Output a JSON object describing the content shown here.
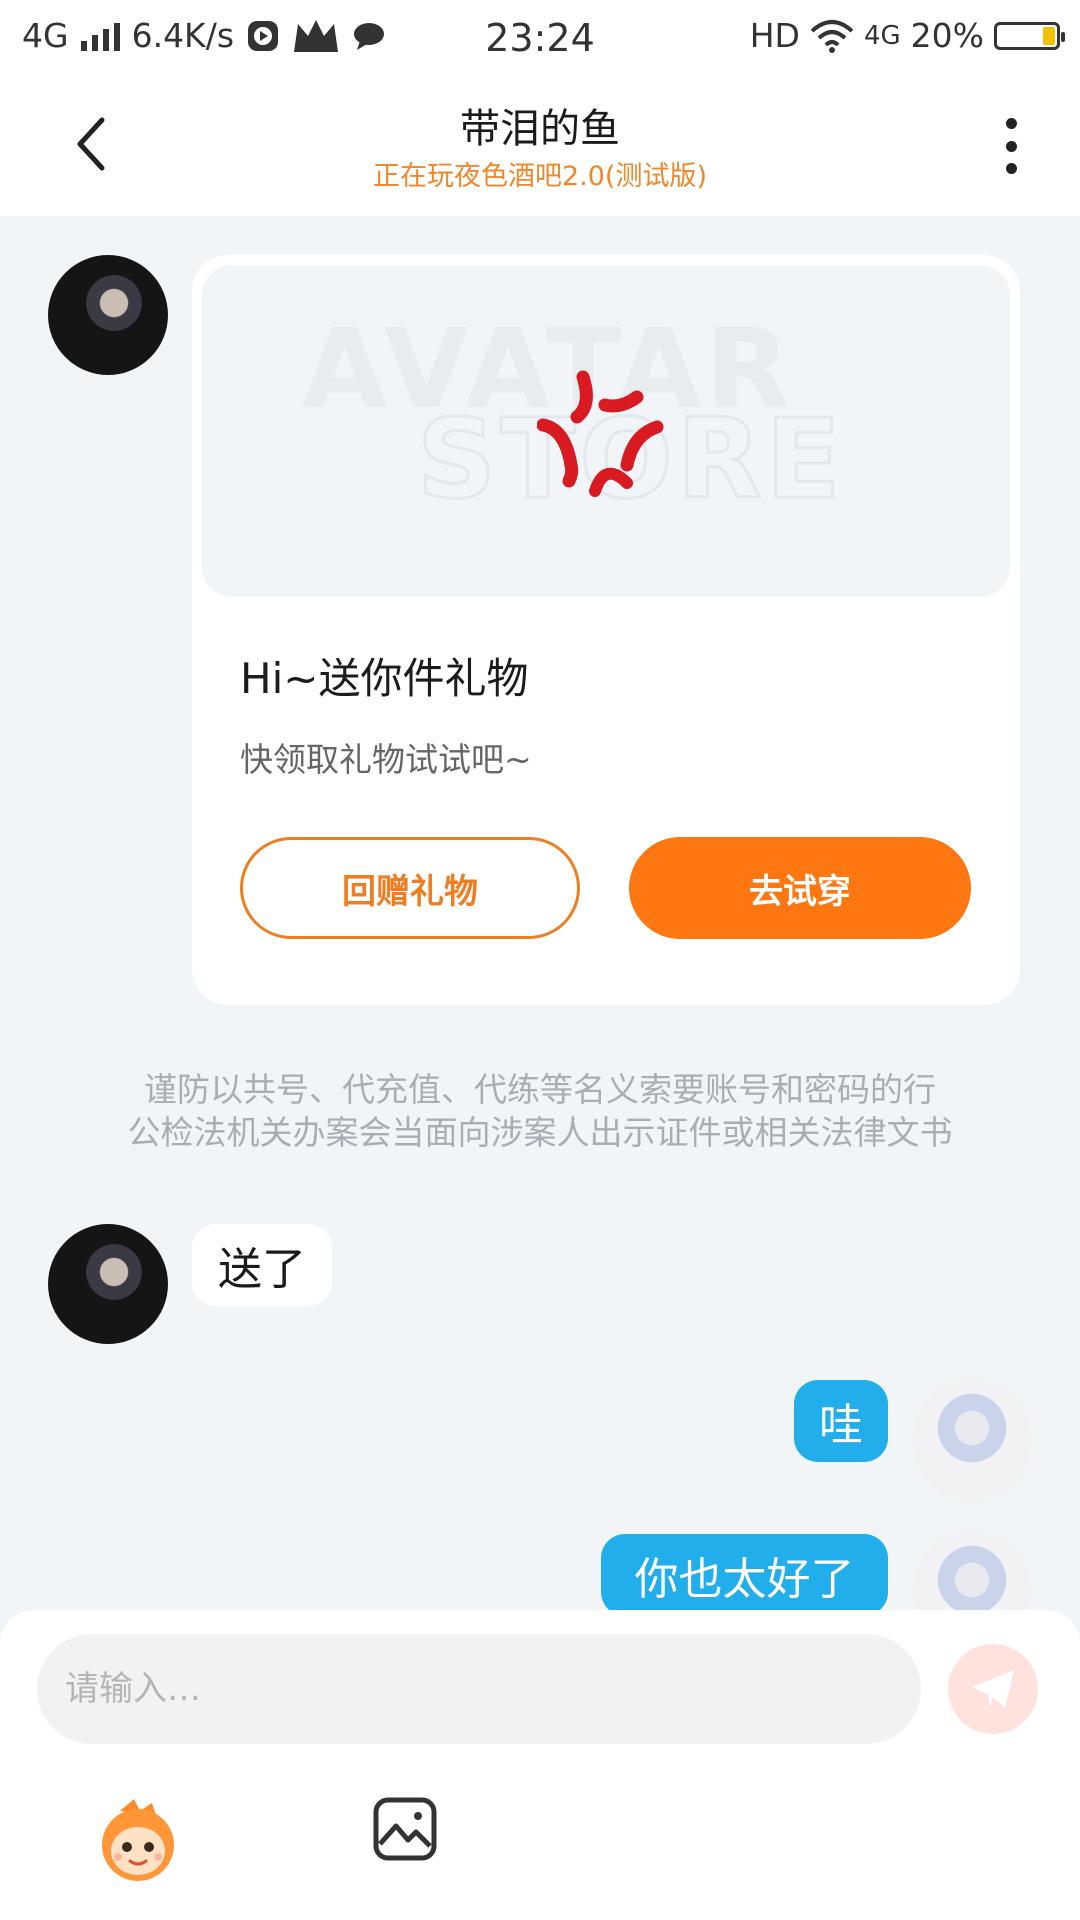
{
  "status_bar": {
    "network": "4G",
    "speed": "6.4K/s",
    "time": "23:24",
    "hd": "HD",
    "network_right": "4G",
    "battery": "20%",
    "icons": [
      "signal-icon",
      "play-icon",
      "crown-icon",
      "chat-bubble-icon",
      "wifi-icon",
      "battery-icon"
    ]
  },
  "header": {
    "title": "带泪的鱼",
    "subtitle": "正在玩夜色酒吧2.0(测试版)",
    "back_icon": "chevron-left-icon",
    "more_icon": "more-vertical-icon"
  },
  "gift_card": {
    "title": "Hi~送你件礼物",
    "description": "快领取礼物试试吧~",
    "return_button": "回赠礼物",
    "try_button": "去试穿",
    "accent_color": "#ff7711"
  },
  "notice": {
    "line1": "谨防以共号、代充值、代练等名义索要账号和密码的行",
    "line2": "公检法机关办案会当面向涉案人出示证件或相关法律文书"
  },
  "messages": [
    {
      "from": "other",
      "text": "送了"
    },
    {
      "from": "self",
      "text": "哇"
    },
    {
      "from": "self",
      "text": "你也太好了"
    }
  ],
  "input": {
    "placeholder": "请输入…",
    "value": ""
  }
}
